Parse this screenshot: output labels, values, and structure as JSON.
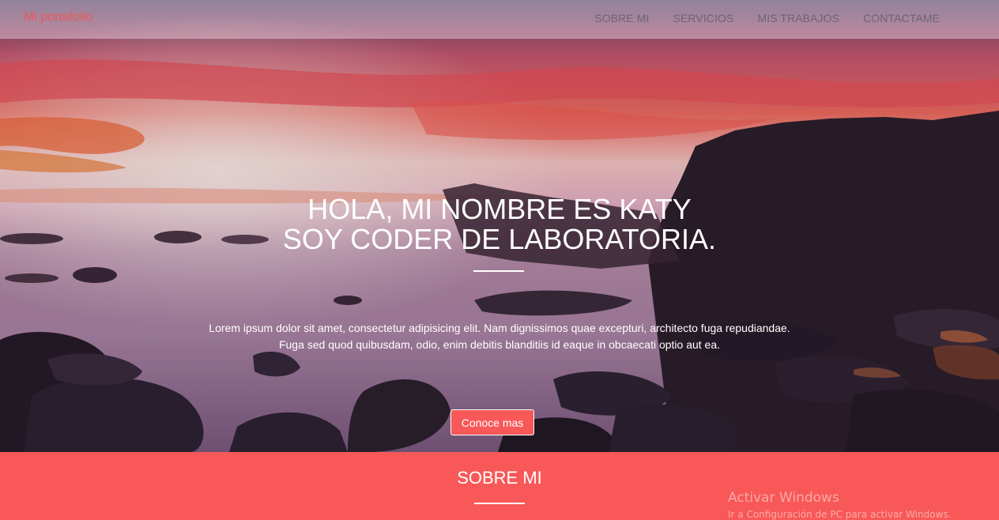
{
  "nav": {
    "brand": "Mi portafolio",
    "links": [
      "SOBRE MI",
      "SERVICIOS",
      "MIS TRABAJOS",
      "CONTACTAME"
    ]
  },
  "hero": {
    "title_line1": "HOLA, MI NOMBRE ES KATY",
    "title_line2": "SOY CODER DE LABORATORIA.",
    "text_line1": "Lorem ipsum dolor sit amet, consectetur adipisicing elit. Nam dignissimos quae excepturi, architecto fuga repudiandae.",
    "text_line2": "Fuga sed quod quibusdam, odio, enim debitis blanditiis id eaque in obcaecati optio aut ea.",
    "button_label": "Conoce mas"
  },
  "about": {
    "title": "SOBRE MI"
  },
  "watermark": {
    "line1": "Activar Windows",
    "line2": "Ir a Configuración de PC para activar Windows."
  },
  "colors": {
    "accent": "#f85858",
    "brand": "#f0565c"
  }
}
